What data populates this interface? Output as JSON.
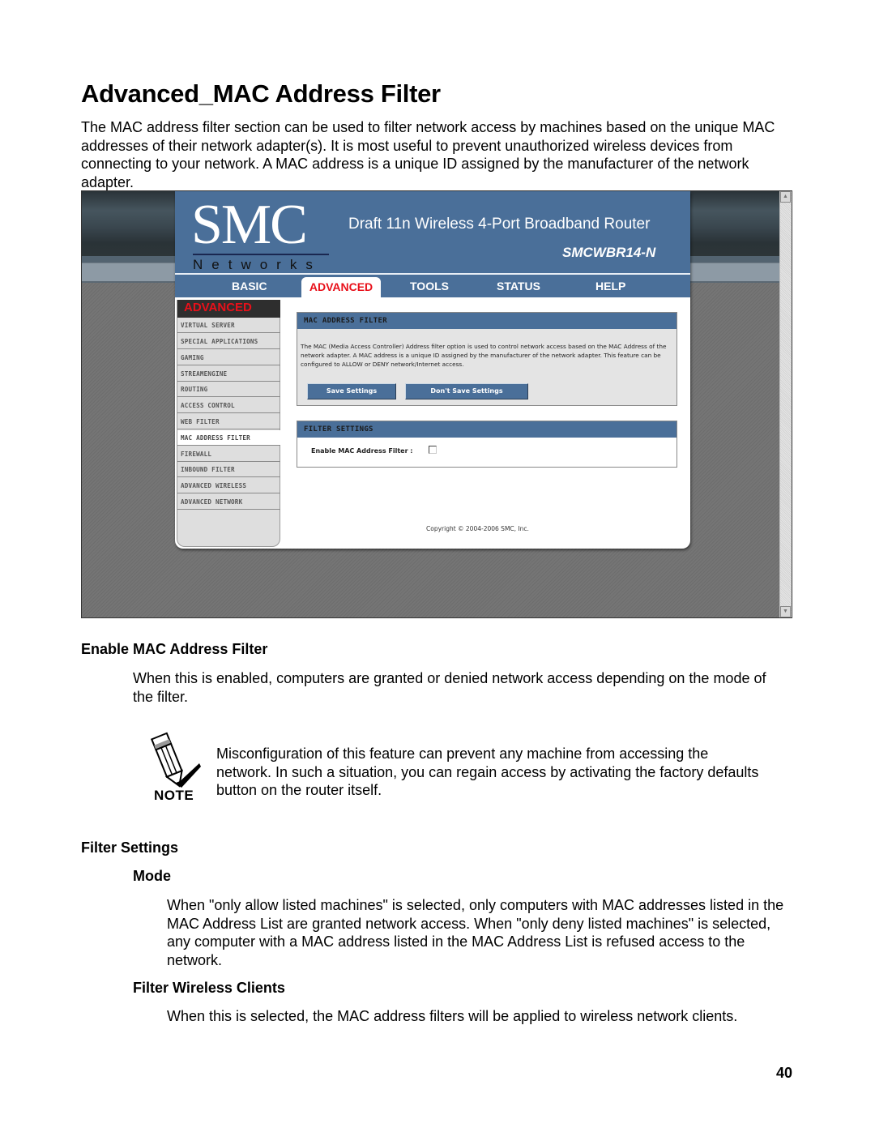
{
  "document": {
    "title": "Advanced_MAC Address Filter",
    "intro": "The MAC address filter section can be used to filter network access by machines based on the unique MAC addresses of their network adapter(s). It is most useful to prevent unauthorized wireless devices from connecting to your network. A MAC address is a unique ID assigned by the manufacturer of the network adapter.",
    "sections": {
      "enable": {
        "heading": "Enable MAC Address Filter",
        "body": "When this is enabled, computers are granted or denied network access depending on the mode of the filter."
      },
      "note": {
        "icon": "pencil-note-icon",
        "label": "NOTE",
        "body": "Misconfiguration of this feature can prevent any machine from accessing the network. In such a situation, you can regain access by activating the factory defaults button on the router itself."
      },
      "filter_settings": {
        "heading": "Filter Settings",
        "mode_heading": "Mode",
        "mode_body": "When \"only allow listed machines\" is selected, only computers with MAC addresses listed in the MAC Address List are granted network access. When \"only deny listed machines\" is selected, any computer with a MAC address listed in the MAC Address List is refused access to the network.",
        "wireless_heading": "Filter Wireless Clients",
        "wireless_body": "When this is selected, the MAC address filters will be applied to wireless network clients."
      }
    },
    "page_number": "40"
  },
  "router_ui": {
    "logo": "SMC",
    "logo_sub": "Networks",
    "product": "Draft 11n Wireless 4-Port Broadband Router",
    "model": "SMCWBR14-N",
    "nav": [
      {
        "label": "BASIC",
        "active": false
      },
      {
        "label": "ADVANCED",
        "active": true
      },
      {
        "label": "TOOLS",
        "active": false
      },
      {
        "label": "STATUS",
        "active": false
      },
      {
        "label": "HELP",
        "active": false
      }
    ],
    "sidebar": {
      "heading": "ADVANCED",
      "items": [
        {
          "label": "VIRTUAL SERVER"
        },
        {
          "label": "SPECIAL APPLICATIONS"
        },
        {
          "label": "GAMING"
        },
        {
          "label": "STREAMENGINE"
        },
        {
          "label": "ROUTING"
        },
        {
          "label": "ACCESS CONTROL"
        },
        {
          "label": "WEB FILTER"
        },
        {
          "label": "MAC ADDRESS FILTER",
          "active": true
        },
        {
          "label": "FIREWALL"
        },
        {
          "label": "INBOUND FILTER"
        },
        {
          "label": "ADVANCED WIRELESS"
        },
        {
          "label": "ADVANCED NETWORK"
        }
      ]
    },
    "mac_panel": {
      "title": "MAC ADDRESS FILTER",
      "description": "The MAC (Media Access Controller) Address filter option is used to control network access based on the MAC Address of the network adapter. A MAC address is a unique ID assigned by the manufacturer of the network adapter. This feature can be configured to ALLOW or DENY network/Internet access.",
      "save_label": "Save Settings",
      "dont_save_label": "Don't Save Settings"
    },
    "filter_panel": {
      "title": "FILTER SETTINGS",
      "enable_label": "Enable MAC Address Filter :",
      "enable_checked": false
    },
    "copyright": "Copyright © 2004-2006 SMC, Inc.",
    "colors": {
      "header_blue": "#4a6f99",
      "active_red": "#e8101a",
      "sidebar_bg": "#dedede"
    }
  }
}
